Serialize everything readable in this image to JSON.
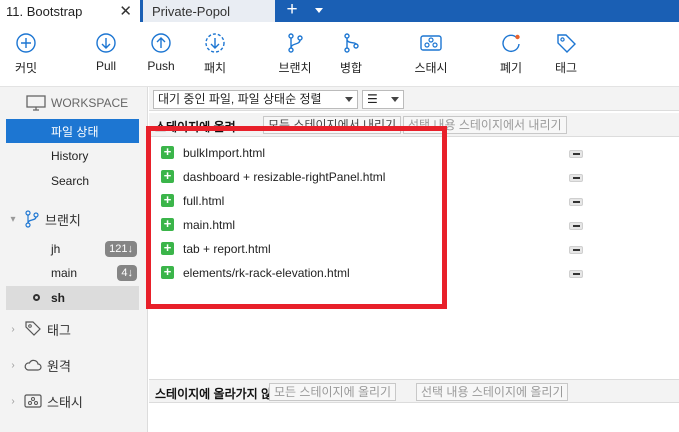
{
  "tabs": [
    {
      "label": "11. Bootstrap",
      "close": "✕",
      "active": true
    },
    {
      "label": "Private-Popol",
      "active": false
    }
  ],
  "tab_add": "+",
  "toolbar": {
    "commit": "커밋",
    "pull": "Pull",
    "push": "Push",
    "fetch": "패치",
    "branch": "브랜치",
    "merge": "병합",
    "stash": "스태시",
    "discard": "폐기",
    "tag": "태그"
  },
  "sidebar": {
    "workspace": "WORKSPACE",
    "file_status": "파일 상태",
    "history": "History",
    "search": "Search",
    "branches": "브랜치",
    "branch_items": [
      {
        "name": "jh",
        "badge": "121↓"
      },
      {
        "name": "main",
        "badge": "4↓"
      },
      {
        "name": "sh",
        "badge": ""
      }
    ],
    "tags": "태그",
    "remotes": "원격",
    "stashes": "스태시"
  },
  "filter": {
    "mode": "대기 중인 파일, 파일 상태순 정렬",
    "view_icon": "☰"
  },
  "staged": {
    "title": "스테이지에 올려",
    "unstage_all": "모든 스테이지에서 내리기",
    "unstage_selected": "선택 내용 스테이지에서 내리기",
    "files": [
      "bulkImport.html",
      "dashboard + resizable-rightPanel.html",
      "full.html",
      "main.html",
      "tab + report.html",
      "elements/rk-rack-elevation.html"
    ]
  },
  "unstaged": {
    "title": "스테이지에 올라가지 않은 파일",
    "stage_all": "모든 스테이지에 올리기",
    "stage_selected": "선택 내용 스테이지에 올리기"
  },
  "colors": {
    "accent": "#1a5fb4",
    "selection": "#1d76d2",
    "add_icon": "#3bb54a",
    "highlight": "#e8202a"
  }
}
